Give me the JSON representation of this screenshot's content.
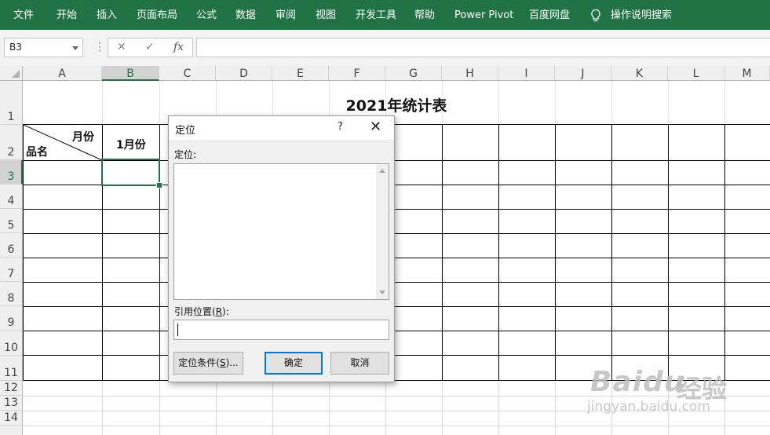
{
  "ribbon": {
    "tabs": [
      "文件",
      "开始",
      "插入",
      "页面布局",
      "公式",
      "数据",
      "审阅",
      "视图",
      "开发工具",
      "帮助",
      "Power Pivot",
      "百度网盘"
    ],
    "tell_me": "操作说明搜索",
    "bg_color": "#217346"
  },
  "formula_bar": {
    "name_box": "B3",
    "cancel_icon": "✕",
    "enter_icon": "✓",
    "fx_label": "fx",
    "formula": ""
  },
  "sheet": {
    "columns": [
      "A",
      "B",
      "C",
      "D",
      "E",
      "F",
      "G",
      "H",
      "I",
      "J",
      "K",
      "L",
      "M"
    ],
    "rows": [
      "1",
      "2",
      "3",
      "4",
      "5",
      "6",
      "7",
      "8",
      "9",
      "10",
      "11",
      "12",
      "13",
      "14"
    ],
    "selected_cell": "B3",
    "title": "2021年统计表",
    "header_month": "月份",
    "header_item": "品名",
    "b2": "1月份"
  },
  "dialog": {
    "title": "定位",
    "help": "?",
    "close": "✕",
    "goto_label": "定位:",
    "reference_label_pre": "引用位置(",
    "reference_label_key": "R",
    "reference_label_post": "):",
    "reference_value": "",
    "special_pre": "定位条件(",
    "special_key": "S",
    "special_post": ")...",
    "ok": "确定",
    "cancel": "取消"
  },
  "watermark": {
    "brand": "Baidu",
    "cn": "经验",
    "url": "jingyan.baidu.com"
  }
}
